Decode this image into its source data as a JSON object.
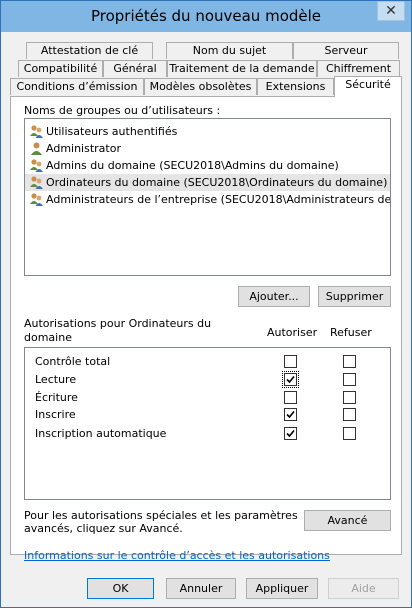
{
  "window": {
    "title": "Propriétés du nouveau modèle",
    "close_glyph": "✕"
  },
  "tabs": {
    "row1": [
      "Attestation de clé",
      "Nom du sujet",
      "Serveur"
    ],
    "row2": [
      "Compatibilité",
      "Général",
      "Traitement de la demande",
      "Chiffrement"
    ],
    "row3": [
      "Conditions d’émission",
      "Modèles obsolètes",
      "Extensions",
      "Sécurité"
    ],
    "active": "Sécurité"
  },
  "groups": {
    "label": "Noms de groupes ou d’utilisateurs :",
    "items": [
      {
        "label": "Utilisateurs authentifiés",
        "icon": "group-icon",
        "selected": false
      },
      {
        "label": "Administrator",
        "icon": "user-icon",
        "selected": false
      },
      {
        "label": "Admins du domaine (SECU2018\\Admins du domaine)",
        "icon": "group-icon",
        "selected": false
      },
      {
        "label": "Ordinateurs du domaine (SECU2018\\Ordinateurs du domaine)",
        "icon": "group-icon",
        "selected": true
      },
      {
        "label": "Administrateurs de l’entreprise (SECU2018\\Administrateurs de l’entrepr...",
        "icon": "group-icon",
        "selected": false
      }
    ],
    "add_label": "Ajouter...",
    "remove_label": "Supprimer"
  },
  "permissions": {
    "title_line1": "Autorisations pour Ordinateurs du",
    "title_line2": "domaine",
    "allow_header": "Autoriser",
    "deny_header": "Refuser",
    "rows": [
      {
        "label": "Contrôle total",
        "allow": false,
        "deny": false
      },
      {
        "label": "Lecture",
        "allow": true,
        "deny": false
      },
      {
        "label": "Écriture",
        "allow": false,
        "deny": false
      },
      {
        "label": "Inscrire",
        "allow": true,
        "deny": false
      },
      {
        "label": "Inscription automatique",
        "allow": true,
        "deny": false
      }
    ]
  },
  "advanced": {
    "text_line1": "Pour les autorisations spéciales et les paramètres",
    "text_line2": "avancés, cliquez sur Avancé.",
    "button_label": "Avancé"
  },
  "help_link": "Informations sur le contrôle d’accès et les autorisations",
  "footer": {
    "ok": "OK",
    "cancel": "Annuler",
    "apply": "Appliquer",
    "help": "Aide"
  },
  "colors": {
    "titlebar": "#7fb6e3",
    "accent": "#0078d7",
    "link": "#0066cc"
  }
}
